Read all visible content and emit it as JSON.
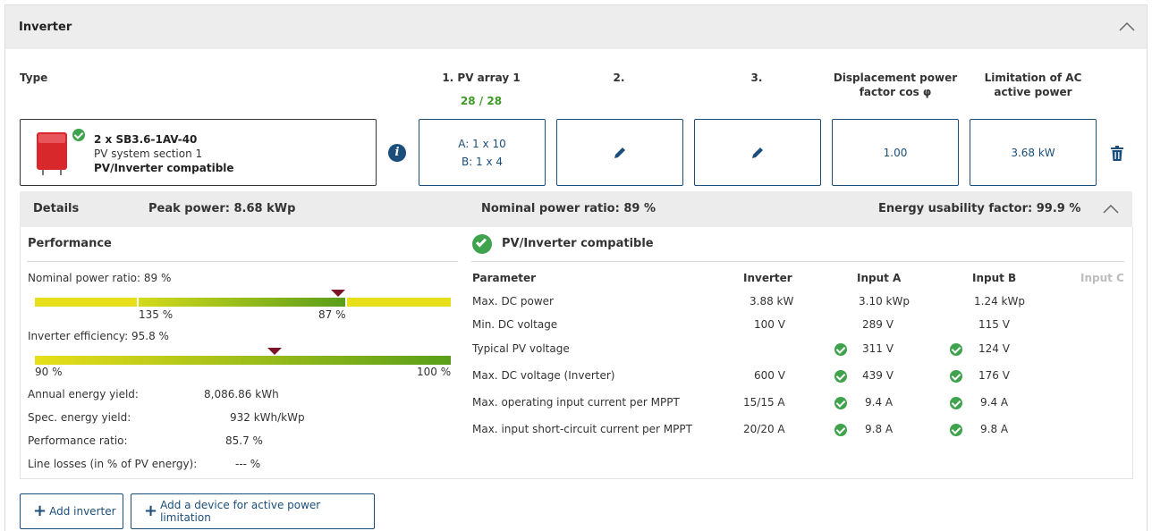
{
  "header": {
    "title": "Inverter"
  },
  "columns": {
    "type": "Type",
    "pv1": "1. PV array 1",
    "pv1_count": "28 / 28",
    "pv2": "2.",
    "pv3": "3.",
    "cosphi_line1": "Displacement power",
    "cosphi_line2": "factor cos φ",
    "ac_line1": "Limitation of AC",
    "ac_line2": "active power"
  },
  "inverter": {
    "model": "2 x SB3.6-1AV-40",
    "section": "PV system section 1",
    "status": "PV/Inverter compatible",
    "pv1_a": "A: 1 x 10",
    "pv1_b": "B: 1 x 4",
    "cosphi": "1.00",
    "ac_limit": "3.68 kW"
  },
  "details": {
    "label": "Details",
    "peak": "Peak power: 8.68 kWp",
    "nominal": "Nominal power ratio: 89 %",
    "usability": "Energy usability factor: 99.9 %"
  },
  "performance": {
    "title": "Performance",
    "nominal_label": "Nominal power ratio: 89 %",
    "bar1": {
      "low_label": "135 %",
      "high_label": "87 %",
      "marker_value": 89
    },
    "efficiency_label": "Inverter efficiency: 95.8 %",
    "bar2": {
      "min_label": "90 %",
      "max_label": "100 %",
      "marker_value": 95.8
    },
    "stats": [
      {
        "label": "Annual energy yield:",
        "value": "8,086.86 kWh"
      },
      {
        "label": "Spec. energy yield:",
        "value": "932 kWh/kWp"
      },
      {
        "label": "Performance ratio:",
        "value": "85.7 %"
      },
      {
        "label": "Line losses (in % of PV energy):",
        "value": "--- %"
      }
    ]
  },
  "compat": {
    "title": "PV/Inverter compatible",
    "headers": {
      "param": "Parameter",
      "inverter": "Inverter",
      "a": "Input A",
      "b": "Input B",
      "c": "Input C"
    },
    "rows": [
      {
        "param": "Max. DC power",
        "inverter": "3.88 kW",
        "a": "3.10 kWp",
        "b": "1.24 kWp",
        "check": false
      },
      {
        "param": "Min. DC voltage",
        "inverter": "100 V",
        "a": "289 V",
        "b": "115 V",
        "check": false
      },
      {
        "param": "Typical PV voltage",
        "inverter": "",
        "a": "311 V",
        "b": "124 V",
        "check": true
      },
      {
        "param": "Max. DC voltage (Inverter)",
        "inverter": "600 V",
        "a": "439 V",
        "b": "176 V",
        "check": true
      },
      {
        "param": "Max. operating input current per MPPT",
        "inverter": "15/15 A",
        "a": "9.4 A",
        "b": "9.4 A",
        "check": true
      },
      {
        "param": "Max. input short-circuit current per MPPT",
        "inverter": "20/20 A",
        "a": "9.8 A",
        "b": "9.8 A",
        "check": true
      }
    ]
  },
  "buttons": {
    "add_inverter": "Add inverter",
    "add_device": "Add a device for active power limitation"
  },
  "colors": {
    "accent": "#1b4e7a",
    "ok": "#3fa34d",
    "marker": "#7a1426"
  }
}
